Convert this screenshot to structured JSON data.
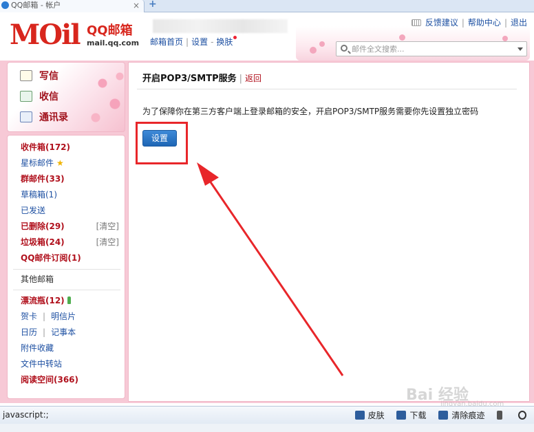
{
  "browser": {
    "tab_title": "QQ邮箱 - 帐户",
    "status_text": "javascript:;",
    "status_items": [
      "皮肤",
      "下载",
      "清除痕迹"
    ]
  },
  "header": {
    "logo_mark": "MOil",
    "logo_cn": "QQ邮箱",
    "logo_url": "mail.qq.com",
    "nav": [
      "邮箱首页",
      "设置",
      "换肤"
    ],
    "top_links": [
      "反馈建议",
      "帮助中心",
      "退出"
    ],
    "search_placeholder": "邮件全文搜索..."
  },
  "sidebar": {
    "compose": [
      {
        "label": "写信",
        "icon": "pen-icon"
      },
      {
        "label": "收信",
        "icon": "inbox-download-icon"
      },
      {
        "label": "通讯录",
        "icon": "contacts-icon"
      }
    ],
    "folders": [
      {
        "label": "收件箱(172)",
        "style": "bold"
      },
      {
        "label": "星标邮件",
        "style": "normal",
        "star": true
      },
      {
        "label": "群邮件(33)",
        "style": "bold"
      },
      {
        "label": "草稿箱(1)",
        "style": "normal"
      },
      {
        "label": "已发送",
        "style": "normal"
      },
      {
        "label": "已删除(29)",
        "style": "bold",
        "clear": "[清空]"
      },
      {
        "label": "垃圾箱(24)",
        "style": "bold",
        "clear": "[清空]"
      },
      {
        "label": "QQ邮件订阅(1)",
        "style": "bold"
      }
    ],
    "other_mail": "其他邮箱",
    "extras": {
      "drift_bottle": "漂流瓶(12)",
      "greeting_card": "贺卡",
      "postcard": "明信片",
      "calendar": "日历",
      "notepad": "记事本",
      "attachments": "附件收藏",
      "file_transfer": "文件中转站",
      "reading_space": "阅读空间(366)"
    }
  },
  "content": {
    "title": "开启POP3/SMTP服务",
    "back_link": "返回",
    "description": "为了保障你在第三方客户端上登录邮箱的安全，开启POP3/SMTP服务需要你先设置独立密码",
    "set_button": "设置"
  },
  "watermark": {
    "text": "Bai 经验",
    "sub": "jingyan.baidu.com"
  },
  "colors": {
    "brand_red": "#d8261d",
    "link_blue": "#1e50a2",
    "folder_red": "#b0101c",
    "button_blue": "#2a74c5",
    "annotation_red": "#e8262a",
    "frame_pink": "#f7c9d6"
  }
}
